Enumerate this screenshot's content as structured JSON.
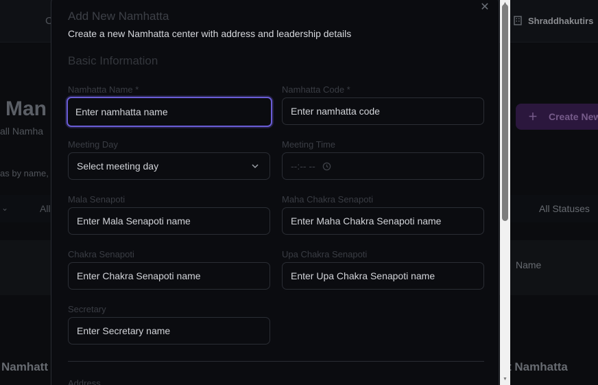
{
  "background": {
    "header_fragment": "C",
    "user_name": "Shraddhakutirs",
    "page_title_fragment": "Man",
    "page_subtitle_fragment": "all Namha",
    "search_fragment": "as by name,",
    "filter_fragment": "All",
    "status_filter": "All Statuses",
    "create_button": "Create New",
    "table_header_name": "Name",
    "footer_left_fragment": "Namhatt",
    "footer_right_fragment": "t Namhatta"
  },
  "modal": {
    "title": "Add New Namhatta",
    "description": "Create a new Namhatta center with address and leadership details",
    "section_basic": "Basic Information",
    "fields": {
      "name": {
        "label": "Namhatta Name *",
        "placeholder": "Enter namhatta name"
      },
      "code": {
        "label": "Namhatta Code *",
        "placeholder": "Enter namhatta code"
      },
      "meeting_day": {
        "label": "Meeting Day",
        "value": "Select meeting day"
      },
      "meeting_time": {
        "label": "Meeting Time",
        "placeholder": "--:-- --"
      },
      "mala_senapoti": {
        "label": "Mala Senapoti",
        "placeholder": "Enter Mala Senapoti name"
      },
      "maha_chakra_senapoti": {
        "label": "Maha Chakra Senapoti",
        "placeholder": "Enter Maha Chakra Senapoti name"
      },
      "chakra_senapoti": {
        "label": "Chakra Senapoti",
        "placeholder": "Enter Chakra Senapoti name"
      },
      "upa_chakra_senapoti": {
        "label": "Upa Chakra Senapoti",
        "placeholder": "Enter Upa Chakra Senapoti name"
      },
      "secretary": {
        "label": "Secretary",
        "placeholder": "Enter Secretary name"
      }
    },
    "section_address": "Address"
  },
  "icons": {
    "close": "close-icon",
    "plus": "plus-icon",
    "building": "building-icon",
    "chevron": "chevron-down-icon",
    "clock": "clock-icon"
  },
  "colors": {
    "accent": "#6a5dd6",
    "modal_bg": "#0b0c10",
    "page_bg": "#0f1115"
  }
}
